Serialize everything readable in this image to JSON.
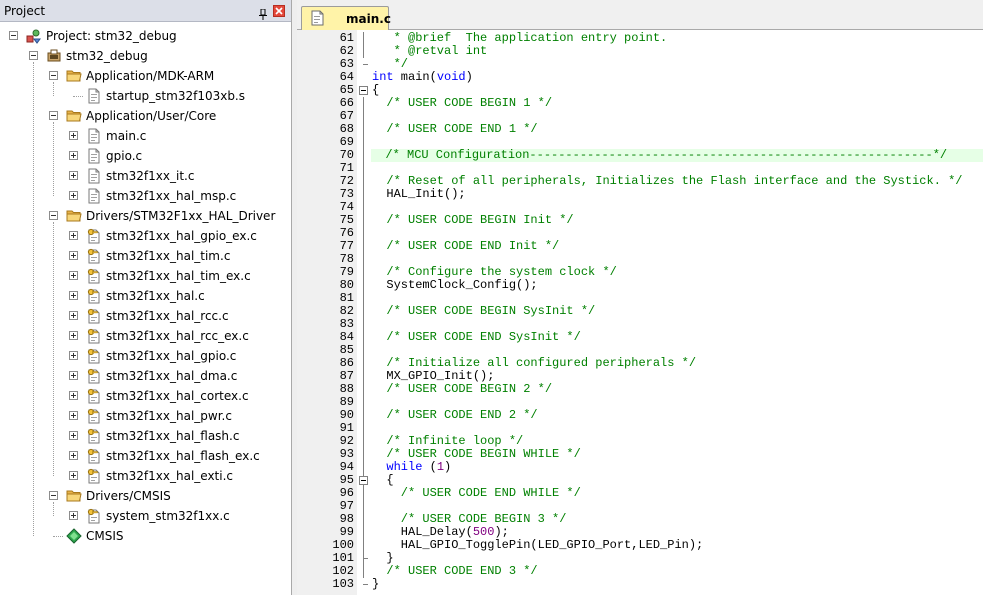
{
  "project_panel": {
    "title": "Project",
    "tree": [
      {
        "label": "Project: stm32_debug",
        "icon": "project-icon"
      },
      {
        "label": "stm32_debug",
        "icon": "target-icon"
      },
      {
        "label": "Application/MDK-ARM",
        "icon": "folder-icon"
      },
      {
        "label": "startup_stm32f103xb.s",
        "icon": "file-icon"
      },
      {
        "label": "Application/User/Core",
        "icon": "folder-icon"
      },
      {
        "label": "main.c",
        "icon": "file-icon"
      },
      {
        "label": "gpio.c",
        "icon": "file-icon"
      },
      {
        "label": "stm32f1xx_it.c",
        "icon": "file-icon"
      },
      {
        "label": "stm32f1xx_hal_msp.c",
        "icon": "file-icon"
      },
      {
        "label": "Drivers/STM32F1xx_HAL_Driver",
        "icon": "folder-icon"
      },
      {
        "label": "stm32f1xx_hal_gpio_ex.c",
        "icon": "file-key-icon"
      },
      {
        "label": "stm32f1xx_hal_tim.c",
        "icon": "file-key-icon"
      },
      {
        "label": "stm32f1xx_hal_tim_ex.c",
        "icon": "file-key-icon"
      },
      {
        "label": "stm32f1xx_hal.c",
        "icon": "file-key-icon"
      },
      {
        "label": "stm32f1xx_hal_rcc.c",
        "icon": "file-key-icon"
      },
      {
        "label": "stm32f1xx_hal_rcc_ex.c",
        "icon": "file-key-icon"
      },
      {
        "label": "stm32f1xx_hal_gpio.c",
        "icon": "file-key-icon"
      },
      {
        "label": "stm32f1xx_hal_dma.c",
        "icon": "file-key-icon"
      },
      {
        "label": "stm32f1xx_hal_cortex.c",
        "icon": "file-key-icon"
      },
      {
        "label": "stm32f1xx_hal_pwr.c",
        "icon": "file-key-icon"
      },
      {
        "label": "stm32f1xx_hal_flash.c",
        "icon": "file-key-icon"
      },
      {
        "label": "stm32f1xx_hal_flash_ex.c",
        "icon": "file-key-icon"
      },
      {
        "label": "stm32f1xx_hal_exti.c",
        "icon": "file-key-icon"
      },
      {
        "label": "Drivers/CMSIS",
        "icon": "folder-icon"
      },
      {
        "label": "system_stm32f1xx.c",
        "icon": "file-key-icon"
      },
      {
        "label": "CMSIS",
        "icon": "cmsis-diamond-icon"
      }
    ]
  },
  "editor": {
    "active_tab": "main.c",
    "highlight_color": "#e6ffe6",
    "lines": [
      {
        "n": "61",
        "text": "   * @brief  The application entry point."
      },
      {
        "n": "62",
        "text": "   * @retval int"
      },
      {
        "n": "63",
        "text": "   */"
      },
      {
        "n": "64",
        "text": "int main(void)"
      },
      {
        "n": "65",
        "text": "{"
      },
      {
        "n": "66",
        "text": "  /* USER CODE BEGIN 1 */"
      },
      {
        "n": "67",
        "text": ""
      },
      {
        "n": "68",
        "text": "  /* USER CODE END 1 */"
      },
      {
        "n": "69",
        "text": ""
      },
      {
        "n": "70",
        "text": "  /* MCU Configuration--------------------------------------------------------*/"
      },
      {
        "n": "71",
        "text": ""
      },
      {
        "n": "72",
        "text": "  /* Reset of all peripherals, Initializes the Flash interface and the Systick. */"
      },
      {
        "n": "73",
        "text": "  HAL_Init();"
      },
      {
        "n": "74",
        "text": ""
      },
      {
        "n": "75",
        "text": "  /* USER CODE BEGIN Init */"
      },
      {
        "n": "76",
        "text": ""
      },
      {
        "n": "77",
        "text": "  /* USER CODE END Init */"
      },
      {
        "n": "78",
        "text": ""
      },
      {
        "n": "79",
        "text": "  /* Configure the system clock */"
      },
      {
        "n": "80",
        "text": "  SystemClock_Config();"
      },
      {
        "n": "81",
        "text": ""
      },
      {
        "n": "82",
        "text": "  /* USER CODE BEGIN SysInit */"
      },
      {
        "n": "83",
        "text": ""
      },
      {
        "n": "84",
        "text": "  /* USER CODE END SysInit */"
      },
      {
        "n": "85",
        "text": ""
      },
      {
        "n": "86",
        "text": "  /* Initialize all configured peripherals */"
      },
      {
        "n": "87",
        "text": "  MX_GPIO_Init();"
      },
      {
        "n": "88",
        "text": "  /* USER CODE BEGIN 2 */"
      },
      {
        "n": "89",
        "text": ""
      },
      {
        "n": "90",
        "text": "  /* USER CODE END 2 */"
      },
      {
        "n": "91",
        "text": ""
      },
      {
        "n": "92",
        "text": "  /* Infinite loop */"
      },
      {
        "n": "93",
        "text": "  /* USER CODE BEGIN WHILE */"
      },
      {
        "n": "94",
        "text": "  while (1)"
      },
      {
        "n": "95",
        "text": "  {"
      },
      {
        "n": "96",
        "text": "    /* USER CODE END WHILE */"
      },
      {
        "n": "97",
        "text": ""
      },
      {
        "n": "98",
        "text": "    /* USER CODE BEGIN 3 */"
      },
      {
        "n": "99",
        "text": "    HAL_Delay(500);"
      },
      {
        "n": "100",
        "text": "    HAL_GPIO_TogglePin(LED_GPIO_Port,LED_Pin);"
      },
      {
        "n": "101",
        "text": "  }"
      },
      {
        "n": "102",
        "text": "  /* USER CODE END 3 */"
      },
      {
        "n": "103",
        "text": "}"
      }
    ]
  }
}
